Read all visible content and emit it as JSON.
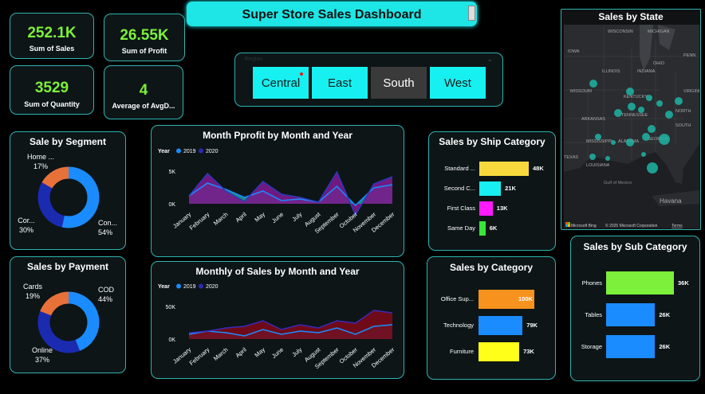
{
  "header": {
    "title": "Super Store Sales Dashboard"
  },
  "kpis": [
    {
      "value": "252.1K",
      "label": "Sum of Sales"
    },
    {
      "value": "26.55K",
      "label": "Sum of Profit"
    },
    {
      "value": "3529",
      "label": "Sum of Quantity"
    },
    {
      "value": "4",
      "label": "Average of AvgD..."
    }
  ],
  "slicer": {
    "title": "Region",
    "options": [
      "Central",
      "East",
      "South",
      "West"
    ],
    "selected": "South"
  },
  "segment": {
    "title": "Sale by Segment",
    "slices": [
      {
        "name": "Con...",
        "pct": "54%",
        "value": 54,
        "color": "#1a8cff"
      },
      {
        "name": "Cor...",
        "pct": "30%",
        "value": 30,
        "color": "#1a2bb0"
      },
      {
        "name": "Home ...",
        "pct": "17%",
        "value": 17,
        "color": "#e8713a"
      }
    ]
  },
  "payment": {
    "title": "Sales by Payment",
    "slices": [
      {
        "name": "COD",
        "pct": "44%",
        "value": 44,
        "color": "#1a8cff"
      },
      {
        "name": "Online",
        "pct": "37%",
        "value": 37,
        "color": "#1a2bb0"
      },
      {
        "name": "Cards",
        "pct": "19%",
        "value": 19,
        "color": "#e8713a"
      }
    ]
  },
  "profit_chart": {
    "title": "Month Pprofit by Month and Year",
    "legend_title": "Year",
    "series": [
      {
        "name": "2019",
        "color": "#1a8cff"
      },
      {
        "name": "2020",
        "color": "#2a2ab8"
      }
    ],
    "yticks": [
      "5K",
      "0K"
    ],
    "months": [
      "January",
      "February",
      "March",
      "April",
      "May",
      "June",
      "July",
      "August",
      "September",
      "October",
      "November",
      "December"
    ]
  },
  "sales_chart": {
    "title": "Monthly of Sales by Month and Year",
    "legend_title": "Year",
    "series": [
      {
        "name": "2019",
        "color": "#1a8cff"
      },
      {
        "name": "2020",
        "color": "#2a2ab8"
      }
    ],
    "yticks": [
      "50K",
      "0K"
    ],
    "months": [
      "January",
      "February",
      "March",
      "April",
      "May",
      "June",
      "July",
      "August",
      "September",
      "October",
      "November",
      "December"
    ]
  },
  "ship": {
    "title": "Sales by Ship Category",
    "bars": [
      {
        "label": "Standard ...",
        "value": "48K",
        "v": 48,
        "color": "#f7d93e"
      },
      {
        "label": "Second C...",
        "value": "21K",
        "v": 21,
        "color": "#17f0f0"
      },
      {
        "label": "First Class",
        "value": "13K",
        "v": 13,
        "color": "#ff1aff"
      },
      {
        "label": "Same Day",
        "value": "6K",
        "v": 6,
        "color": "#39e639"
      }
    ]
  },
  "category": {
    "title": "Sales by Category",
    "bars": [
      {
        "label": "Office Sup...",
        "value": "100K",
        "v": 100,
        "color": "#f7921e"
      },
      {
        "label": "Technology",
        "value": "79K",
        "v": 79,
        "color": "#1a8cff"
      },
      {
        "label": "Furniture",
        "value": "73K",
        "v": 73,
        "color": "#ffff1a"
      }
    ]
  },
  "subcategory": {
    "title": "Sales by Sub Category",
    "bars": [
      {
        "label": "Phones",
        "value": "36K",
        "v": 36,
        "color": "#7cf03a"
      },
      {
        "label": "Tables",
        "value": "26K",
        "v": 26,
        "color": "#1a8cff"
      },
      {
        "label": "Storage",
        "value": "26K",
        "v": 26,
        "color": "#1a8cff"
      }
    ]
  },
  "map": {
    "title": "Sales by State",
    "labels": [
      "WISCONSIN",
      "MICHIGAN",
      "IOWA",
      "ILLINOIS",
      "INDIANA",
      "OHIO",
      "PENN",
      "MISSOURI",
      "KENTUCKY",
      "VIRGINIA",
      "TENNESSEE",
      "ARKANSAS",
      "NORTH",
      "SOUTH",
      "MISSISSIPPI",
      "ALABAMA",
      "GEORGIA",
      "TEXAS",
      "LOUISIANA",
      "Gulf of Mexico",
      "Havana"
    ],
    "attribution": "Microsoft Bing",
    "copyright": "© 2025 Microsoft Corporation",
    "terms": "Terms"
  }
}
